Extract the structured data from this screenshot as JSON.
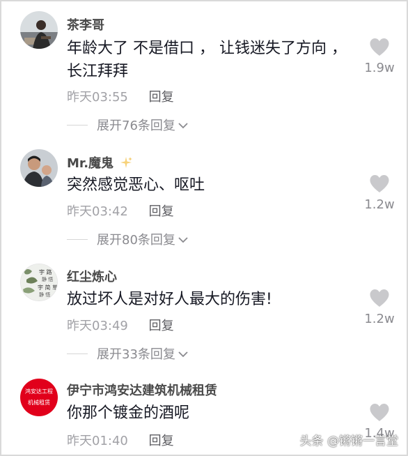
{
  "comments": [
    {
      "username": "茶李哥",
      "content": "年龄大了 不是借口 ， 让钱迷失了方向 ，长江拜拜",
      "time": "昨天03:55",
      "reply_label": "回复",
      "expand_label": "展开76条回复",
      "likes": "1.9w",
      "avatar_icon": "person-photo-avatar"
    },
    {
      "username": "Mr.魔鬼",
      "content": "突然感觉恶心、呕吐",
      "time": "昨天03:42",
      "reply_label": "回复",
      "expand_label": "展开80条回复",
      "likes": "1.2w",
      "avatar_icon": "two-people-photo-avatar"
    },
    {
      "username": "红尘炼心",
      "content": "放过坏人是对好人最大的伤害!",
      "time": "昨天03:49",
      "reply_label": "回复",
      "expand_label": "展开33条回复",
      "likes": "1.2w",
      "avatar_icon": "calligraphy-avatar"
    },
    {
      "username": "伊宁市鸿安达建筑机械租赁",
      "content": "你那个镀金的酒呢",
      "time": "昨天01:40",
      "reply_label": "回复",
      "likes": "1.4w",
      "avatar_icon": "red-logo-avatar",
      "avatar_text_line1": "鸿安达工程",
      "avatar_text_line2": "机械租赁"
    }
  ],
  "watermark": "头条 @锵锵一言堂",
  "colors": {
    "heart": "#c9c9cc",
    "meta": "#a1a1a6",
    "text": "#161823",
    "logo_red": "#e1001b"
  }
}
